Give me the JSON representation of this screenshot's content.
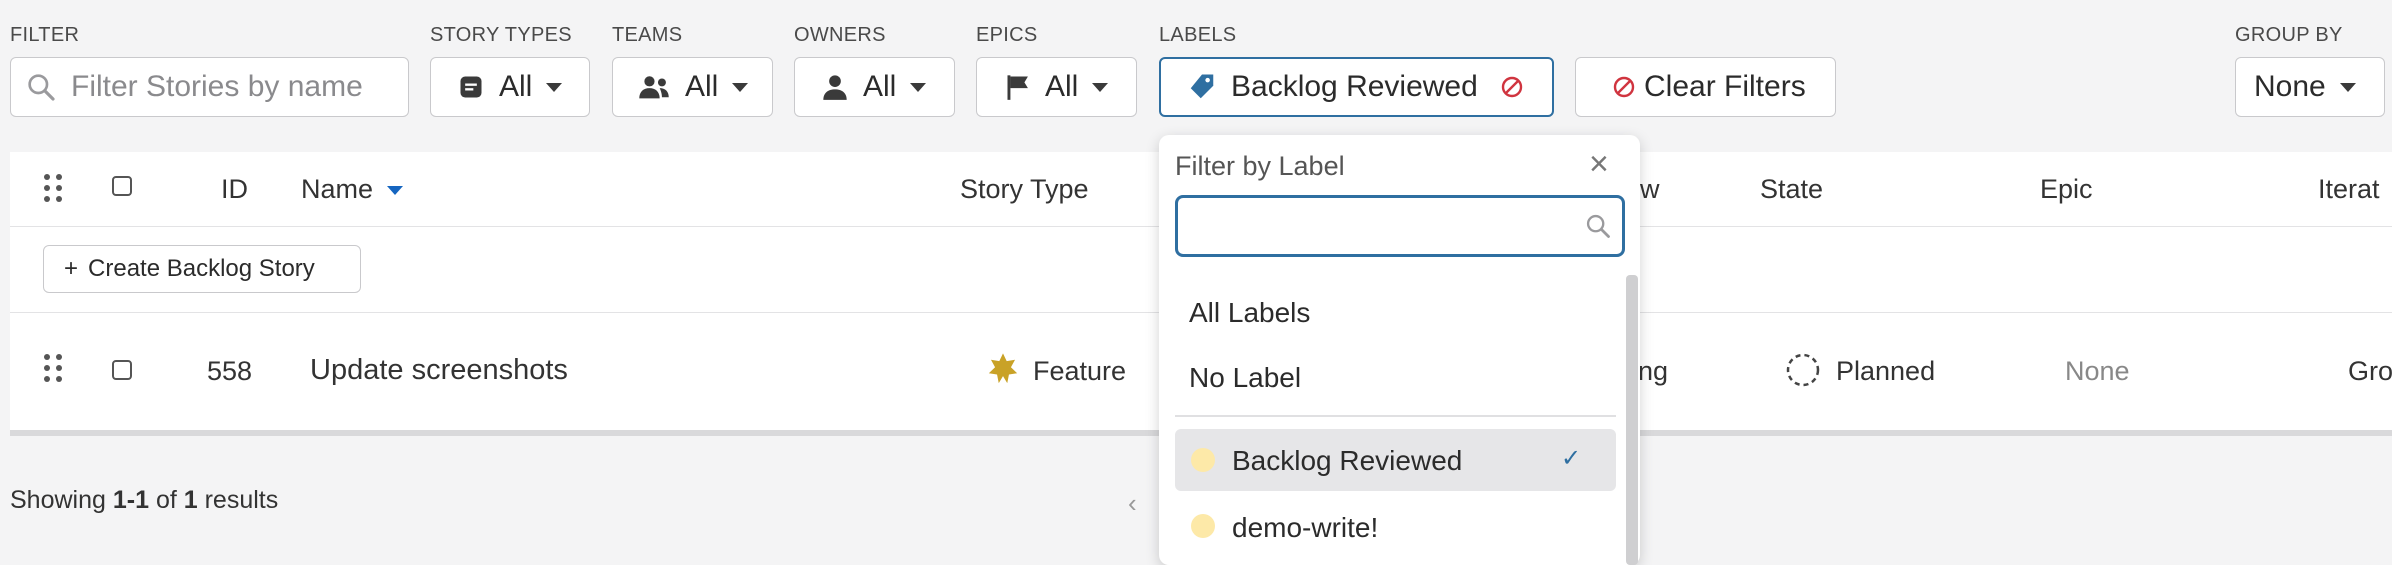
{
  "filters": {
    "filter_label": "FILTER",
    "search_placeholder": "Filter Stories by name",
    "story_types": {
      "label": "STORY TYPES",
      "value": "All"
    },
    "teams": {
      "label": "TEAMS",
      "value": "All"
    },
    "owners": {
      "label": "OWNERS",
      "value": "All"
    },
    "epics": {
      "label": "EPICS",
      "value": "All"
    },
    "labels": {
      "label": "LABELS",
      "value": "Backlog Reviewed"
    },
    "clear_label": "Clear Filters",
    "group_by": {
      "label": "GROUP BY",
      "value": "None"
    }
  },
  "table": {
    "headers": {
      "id": "ID",
      "name": "Name",
      "story_type": "Story Type",
      "workflow_partial": "w",
      "state": "State",
      "epic": "Epic",
      "iteration_partial": "Iterat"
    },
    "create_button": "Create Backlog Story",
    "create_plus": "+",
    "rows": [
      {
        "id": "558",
        "name": "Update screenshots",
        "type": "Feature",
        "team_partial": "eering",
        "state": "Planned",
        "epic": "None",
        "iteration_partial": "Gro"
      }
    ]
  },
  "footer": {
    "prefix": "Showing ",
    "range": "1-1",
    "of": " of ",
    "total": "1",
    "suffix": " results"
  },
  "dropdown": {
    "title": "Filter by Label",
    "close": "×",
    "options": [
      "All Labels",
      "No Label"
    ],
    "labels": [
      {
        "name": "Backlog Reviewed",
        "selected": true,
        "color": "#fde9a8"
      },
      {
        "name": "demo-write!",
        "selected": false,
        "color": "#fde9a8"
      }
    ],
    "check": "✓"
  },
  "colors": {
    "accent": "#2f6fa1",
    "feature_icon": "#c9a227",
    "danger": "#d0343f",
    "sort_arrow": "#1565c0"
  }
}
